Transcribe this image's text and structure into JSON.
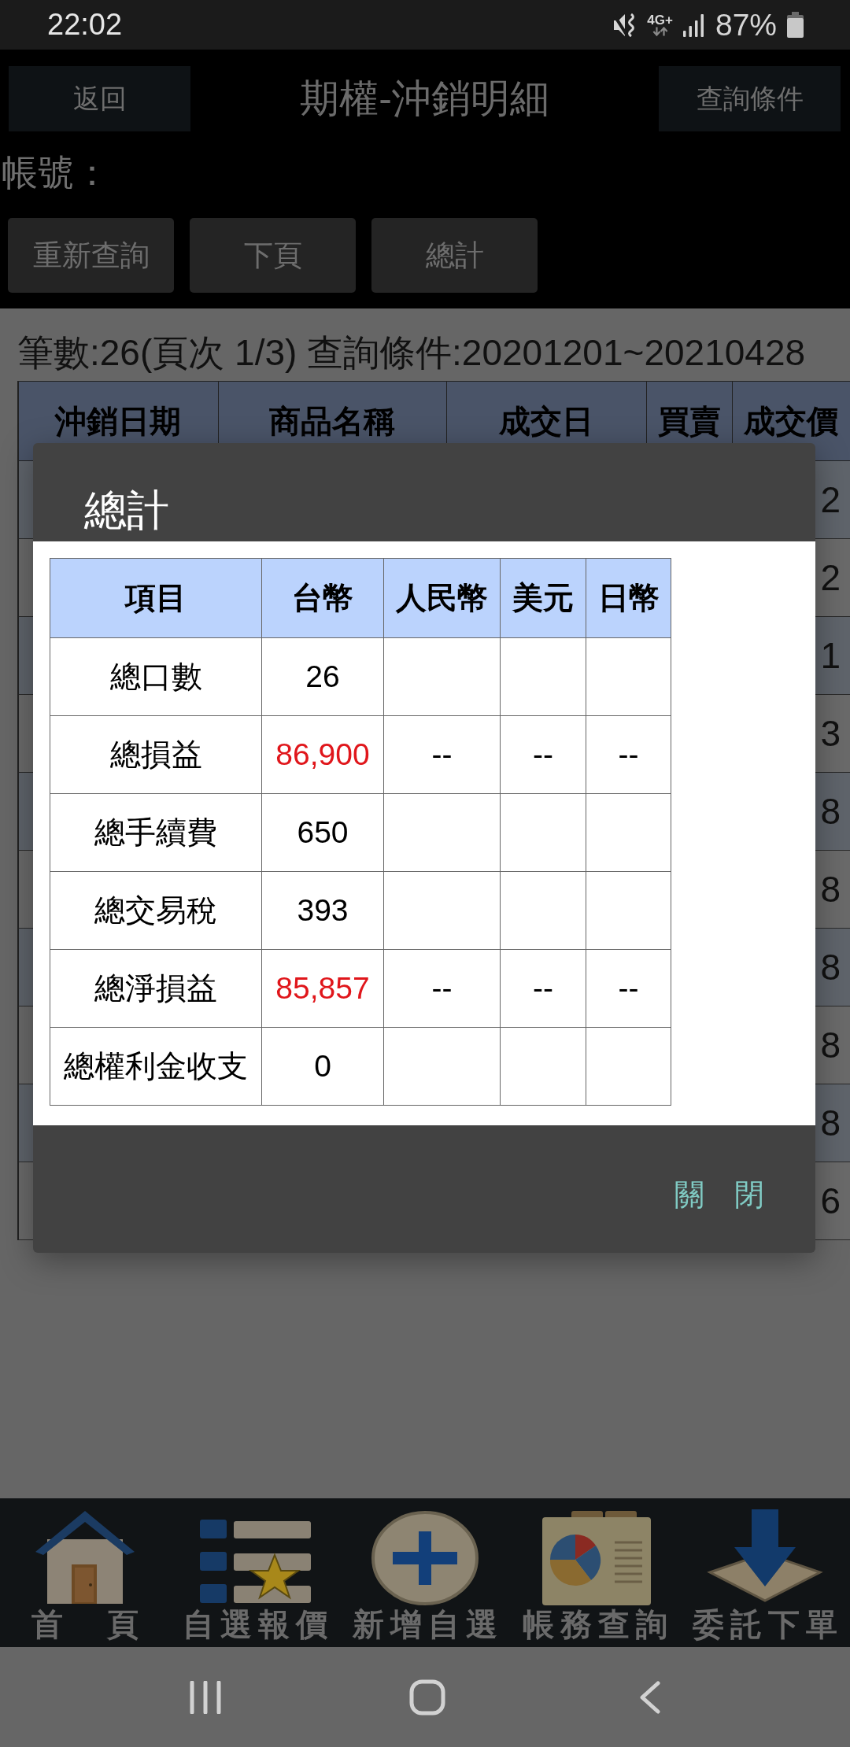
{
  "status_bar": {
    "time": "22:02",
    "network": "4G+",
    "battery": "87%"
  },
  "header": {
    "back": "返回",
    "title": "期權-沖銷明細",
    "query_conditions": "查詢條件"
  },
  "account": {
    "label": "帳號："
  },
  "actions": [
    "重新查詢",
    "下頁",
    "總計"
  ],
  "summary_line": "筆數:26(頁次 1/3) 查詢條件:20201201~20210428",
  "table": {
    "columns": [
      "沖銷日期",
      "商品名稱",
      "成交日",
      "買賣",
      "成交價"
    ],
    "rows": [
      {
        "trade_price": "2"
      },
      {
        "trade_price": "2"
      },
      {
        "trade_price": "1"
      },
      {
        "trade_price": "3"
      },
      {
        "trade_price": "8"
      },
      {
        "trade_price": "8"
      },
      {
        "trade_price": "8"
      },
      {
        "trade_price": "8"
      },
      {
        "trade_price": "8"
      },
      {
        "trade_price": "6"
      }
    ]
  },
  "dialog": {
    "title": "總計",
    "columns": [
      "項目",
      "台幣",
      "人民幣",
      "美元",
      "日幣"
    ],
    "rows": [
      {
        "item": "總口數",
        "twd": {
          "text": "26",
          "color": "#000000"
        }
      },
      {
        "item": "總損益",
        "twd": {
          "text": "86,900",
          "color": "#e0161b"
        },
        "rmb": "--",
        "usd": "--",
        "jpy": "--"
      },
      {
        "item": "總手續費",
        "twd": {
          "text": "650",
          "color": "#000000"
        }
      },
      {
        "item": "總交易稅",
        "twd": {
          "text": "393",
          "color": "#000000"
        }
      },
      {
        "item": "總淨損益",
        "twd": {
          "text": "85,857",
          "color": "#e0161b"
        },
        "rmb": "--",
        "usd": "--",
        "jpy": "--"
      },
      {
        "item": "總權利金收支",
        "twd": {
          "text": "0",
          "color": "#000000"
        }
      }
    ],
    "close": "關　閉"
  },
  "bottom_nav": [
    {
      "label": "首　頁"
    },
    {
      "label": "自選報價"
    },
    {
      "label": "新增自選"
    },
    {
      "label": "帳務查詢"
    },
    {
      "label": "委託下單"
    }
  ]
}
